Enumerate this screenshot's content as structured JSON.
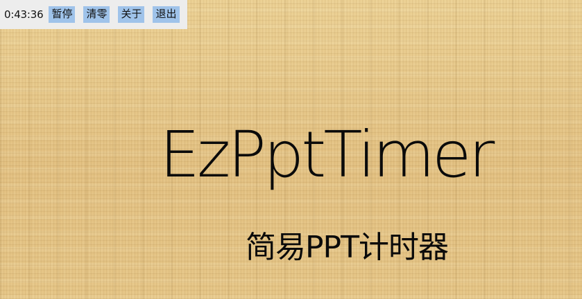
{
  "toolbar": {
    "timer": "0:43:36",
    "pause_label": "暂停",
    "reset_label": "清零",
    "about_label": "关于",
    "exit_label": "退出"
  },
  "slide": {
    "title": "EzPptTimer",
    "subtitle": "简易PPT计时器"
  },
  "colors": {
    "toolbar_bg": "#ededed",
    "button_bg": "#9fc3ea",
    "slide_bg": "#e8c98a",
    "text": "#0a0a0a"
  }
}
